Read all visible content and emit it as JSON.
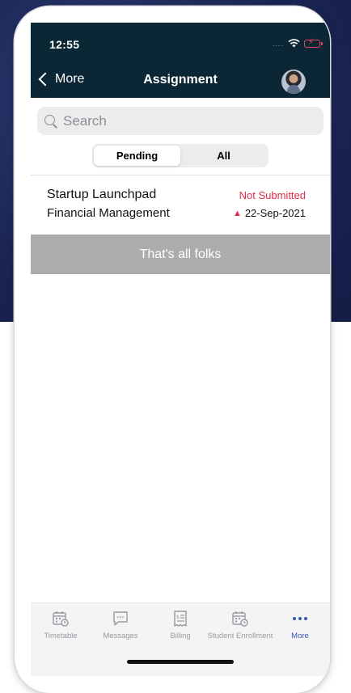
{
  "status_bar": {
    "time": "12:55",
    "signal": "....",
    "wifi_icon": "wifi-icon",
    "battery_icon": "battery-charging-icon"
  },
  "nav": {
    "back_label": "More",
    "title": "Assignment",
    "avatar_icon": "user-avatar"
  },
  "search": {
    "placeholder": "Search",
    "value": ""
  },
  "segments": [
    {
      "label": "Pending",
      "active": true
    },
    {
      "label": "All",
      "active": false
    }
  ],
  "assignments": [
    {
      "title": "Startup Launchpad",
      "subject": "Financial Management",
      "status": "Not Submitted",
      "warning_icon": "▲",
      "due_date": "22-Sep-2021"
    }
  ],
  "end_banner": "That's all folks",
  "tab_bar": {
    "items": [
      {
        "label": "Timetable",
        "icon": "calendar-clock-icon",
        "active": false
      },
      {
        "label": "Messages",
        "icon": "chat-bubble-icon",
        "active": false
      },
      {
        "label": "Billing",
        "icon": "receipt-icon",
        "active": false
      },
      {
        "label": "Student Enrollment",
        "icon": "calendar-clock-icon",
        "active": false
      },
      {
        "label": "More",
        "icon": "more-dots-icon",
        "active": true
      }
    ]
  },
  "colors": {
    "header_bg": "#0b2634",
    "status_red": "#e52b45",
    "active_tab": "#2f5bb0",
    "banner_gray": "#acacac"
  }
}
